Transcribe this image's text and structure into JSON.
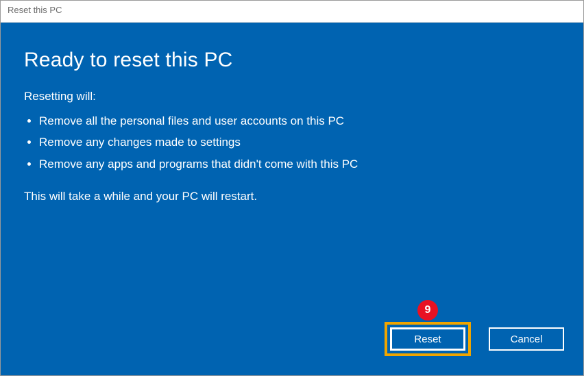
{
  "titlebar": {
    "title": "Reset this PC"
  },
  "main": {
    "heading": "Ready to reset this PC",
    "subheading": "Resetting will:",
    "bullets": [
      "Remove all the personal files and user accounts on this PC",
      "Remove any changes made to settings",
      "Remove any apps and programs that didn't come with this PC"
    ],
    "note": "This will take a while and your PC will restart."
  },
  "buttons": {
    "reset_label": "Reset",
    "cancel_label": "Cancel"
  },
  "annotation": {
    "step_number": "9",
    "step_color": "#e81123",
    "highlight_color": "#f0a500"
  },
  "colors": {
    "background": "#0063b1",
    "text": "#ffffff"
  }
}
